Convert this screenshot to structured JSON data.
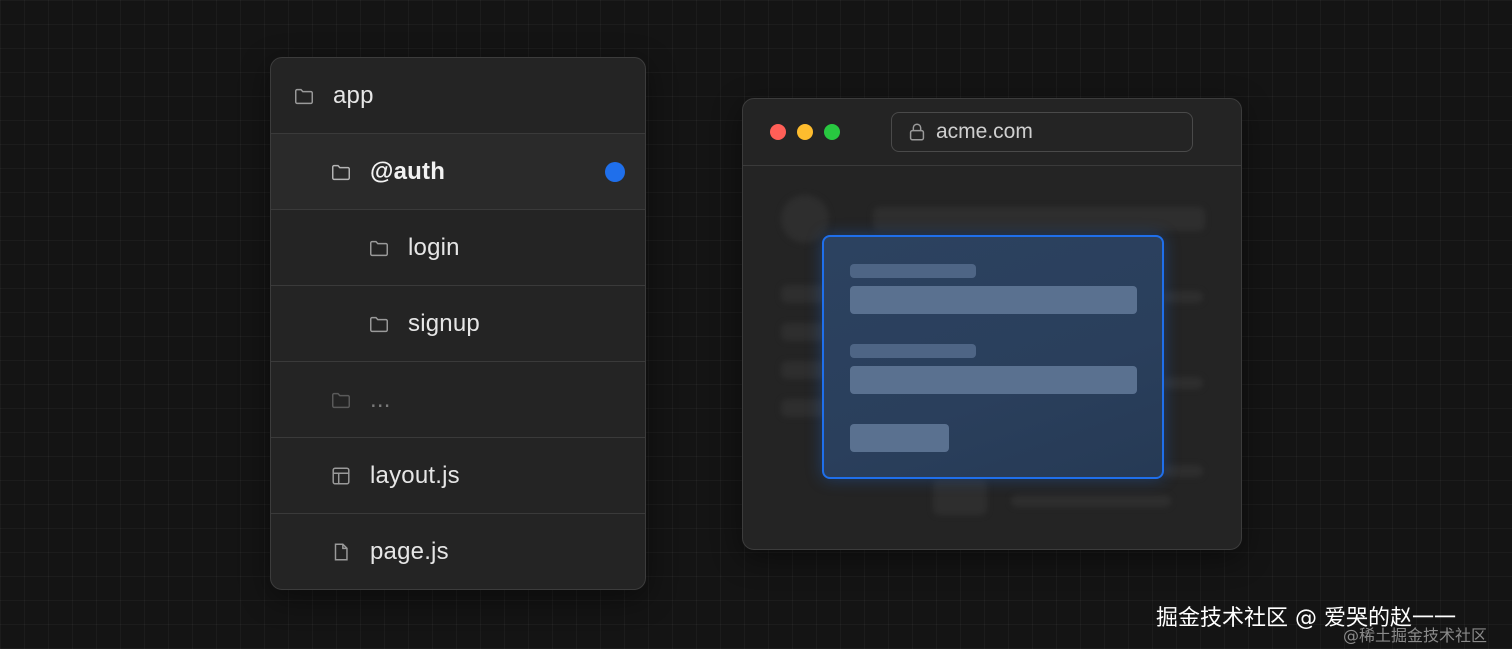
{
  "tree": {
    "items": [
      {
        "label": "app",
        "icon": "folder-icon"
      },
      {
        "label": "@auth",
        "icon": "folder-icon",
        "indicator_color": "#1f6feb"
      },
      {
        "label": "login",
        "icon": "folder-icon"
      },
      {
        "label": "signup",
        "icon": "folder-icon"
      },
      {
        "label": "...",
        "icon": "folder-icon"
      },
      {
        "label": "layout.js",
        "icon": "layout-icon"
      },
      {
        "label": "page.js",
        "icon": "file-icon"
      }
    ]
  },
  "browser": {
    "url": "acme.com",
    "traffic_lights": [
      "#ff5f57",
      "#febc2e",
      "#28c840"
    ],
    "modal_border_color": "#1f6feb"
  },
  "watermark": {
    "line1": "掘金技术社区 @ 爱哭的赵一一",
    "line2": "@稀土掘金技术社区"
  }
}
